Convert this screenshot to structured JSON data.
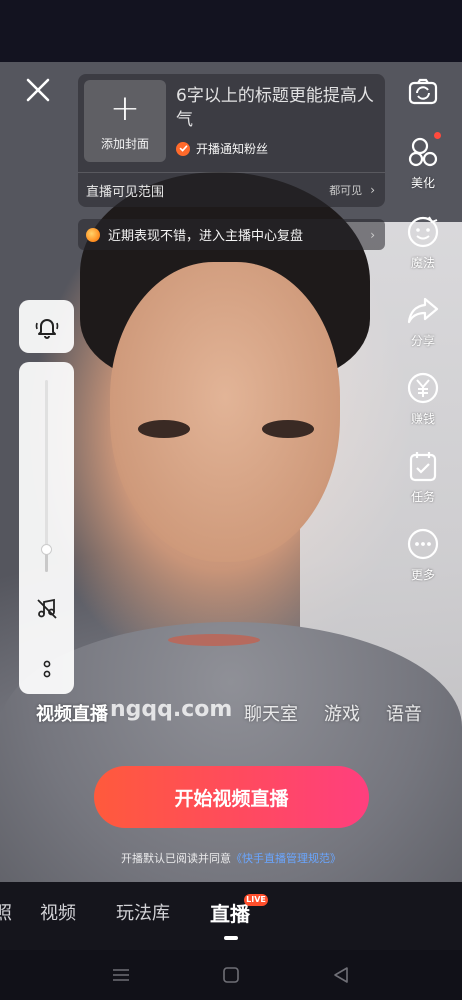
{
  "header": {
    "cover_plus": "+",
    "cover_label": "添加封面",
    "title_placeholder": "6字以上的标题更能提高人气",
    "notify_fans_label": "开播通知粉丝",
    "visibility_label": "直播可见范围",
    "visibility_value": "都可见",
    "chevron": "›"
  },
  "review_banner": {
    "text": "近期表现不错，进入主播中心复盘",
    "chevron": "›"
  },
  "right_tools": [
    {
      "label": "",
      "icon": "flip-camera-icon"
    },
    {
      "label": "美化",
      "icon": "beautify-icon"
    },
    {
      "label": "魔法",
      "icon": "magic-icon"
    },
    {
      "label": "分享",
      "icon": "share-icon"
    },
    {
      "label": "赚钱",
      "icon": "earn-icon"
    },
    {
      "label": "任务",
      "icon": "task-icon"
    },
    {
      "label": "更多",
      "icon": "more-icon"
    }
  ],
  "left_controls": {
    "bell_icon": "bell-icon",
    "music_off_icon": "music-off-icon",
    "more_icon": "vertical-dots-icon",
    "slider_level": 0.12
  },
  "mode_tabs": [
    {
      "label": "视频直播",
      "active": true
    },
    {
      "label": "聊天室",
      "active": false
    },
    {
      "label": "游戏",
      "active": false
    },
    {
      "label": "语音",
      "active": false
    }
  ],
  "watermark": "ngqq.com",
  "start_button": {
    "label": "开始视频直播"
  },
  "agreement": {
    "prefix": "开播默认已阅读并同意",
    "link": "《快手直播管理规范》"
  },
  "bottom_nav": [
    {
      "label": "照",
      "active": false
    },
    {
      "label": "视频",
      "active": false
    },
    {
      "label": "玩法库",
      "active": false
    },
    {
      "label": "直播",
      "active": true,
      "badge": "LIVE"
    }
  ],
  "colors": {
    "accent_orange": "#ff6a2b",
    "start_gradient_start": "#ff5a3c",
    "start_gradient_end": "#ff3f7e",
    "link_blue": "#6aa6ff",
    "live_badge": "#ff4f2c"
  },
  "system_nav": [
    "menu-icon",
    "home-icon",
    "back-icon"
  ]
}
